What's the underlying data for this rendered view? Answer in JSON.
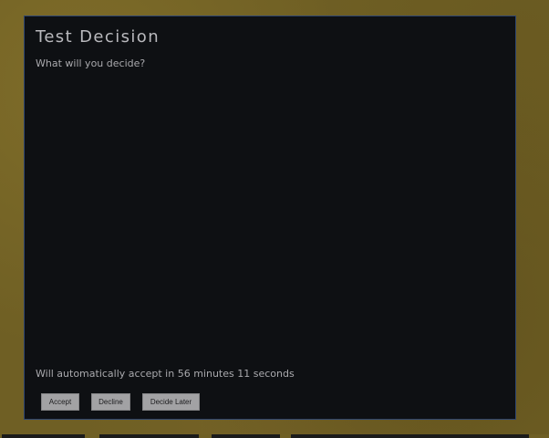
{
  "dialog": {
    "title": "Test Decision",
    "prompt": "What will you decide?",
    "countdown_text": "Will automatically accept in 56 minutes 11 seconds"
  },
  "buttons": {
    "accept_label": "Accept",
    "decline_label": "Decline",
    "later_label": "Decide Later"
  },
  "colors": {
    "background": "#6f5f24",
    "dialog_background": "#0e1013",
    "dialog_border": "#2f4670",
    "button_background": "#a2a2a4",
    "text": "#b9b9bd"
  }
}
